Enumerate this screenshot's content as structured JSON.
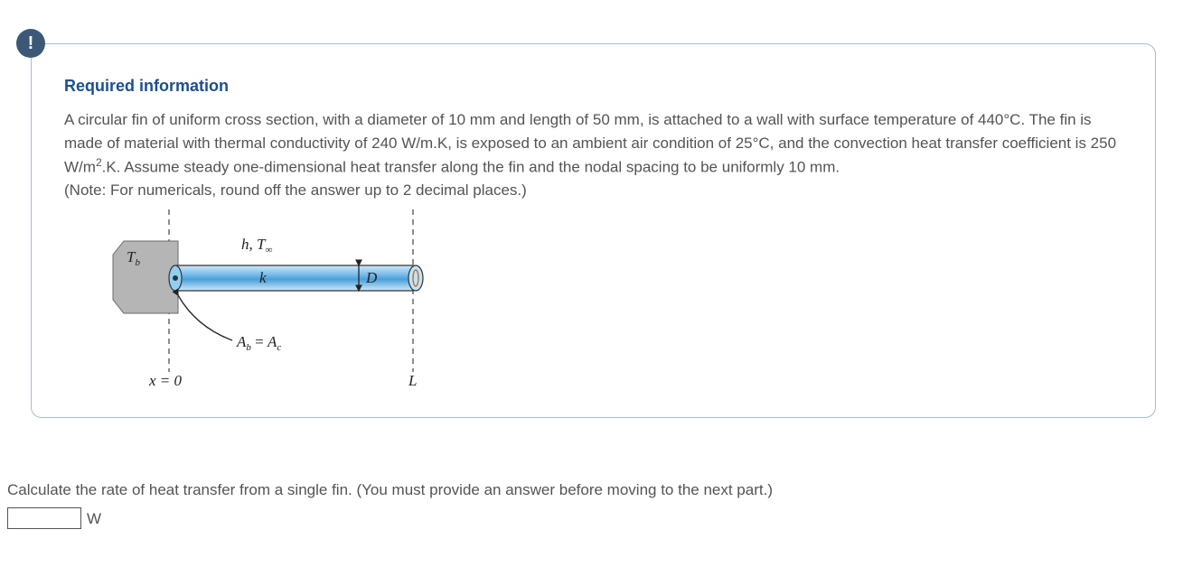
{
  "badge": {
    "symbol": "!"
  },
  "info": {
    "title": "Required information",
    "paragraph1": "A circular fin of uniform cross section, with a diameter of 10 mm and length of 50 mm, is attached to a wall with surface temperature of 440°C. The fin is made of material with thermal conductivity of 240 W/m.K, is exposed to an ambient air condition of 25°C, and the convection heat transfer coefficient is 250 W/m",
    "sup1": "2",
    "paragraph1b": ".K. Assume steady one-dimensional heat transfer along the fin and the nodal spacing to be uniformly 10 mm.",
    "note": "(Note: For numericals, round off the answer up to 2 decimal places.)"
  },
  "diagram": {
    "tb": "T",
    "tb_sub": "b",
    "htinf": "h, T",
    "tinf_sub": "∞",
    "k": "k",
    "D": "D",
    "Ab": "A",
    "Ab_sub": "b",
    "eq": " = ",
    "Ac": "A",
    "Ac_sub": "c",
    "x0": "x = 0",
    "L": "L"
  },
  "question": {
    "text": "Calculate the rate of heat transfer from a single fin. (You must provide an answer before moving to the next part.)",
    "unit": "W"
  }
}
